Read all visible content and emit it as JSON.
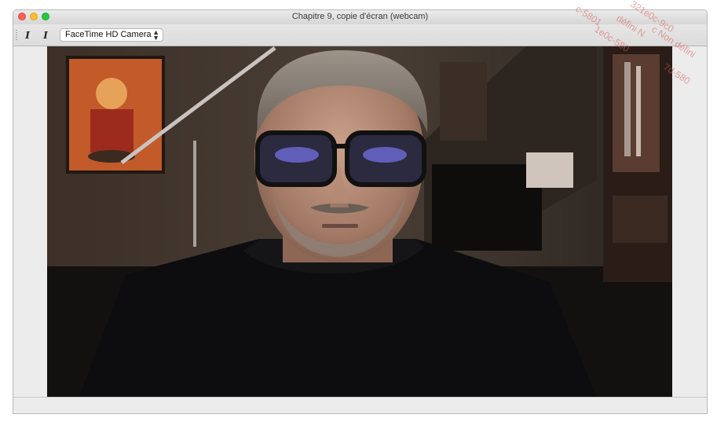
{
  "window": {
    "title": "Chapitre 9, copie d'écran (webcam)"
  },
  "toolbar": {
    "tool1_label": "𝑰",
    "tool2_label": "𝑰",
    "camera_select": {
      "value": "FaceTime HD Camera",
      "chevron": "⌃⌄"
    }
  },
  "watermark": {
    "lines": [
      "c-5801",
      "321e0c-9c0",
      "défini N",
      "c Non défini",
      "1e0c-580",
      "7d-580"
    ]
  }
}
